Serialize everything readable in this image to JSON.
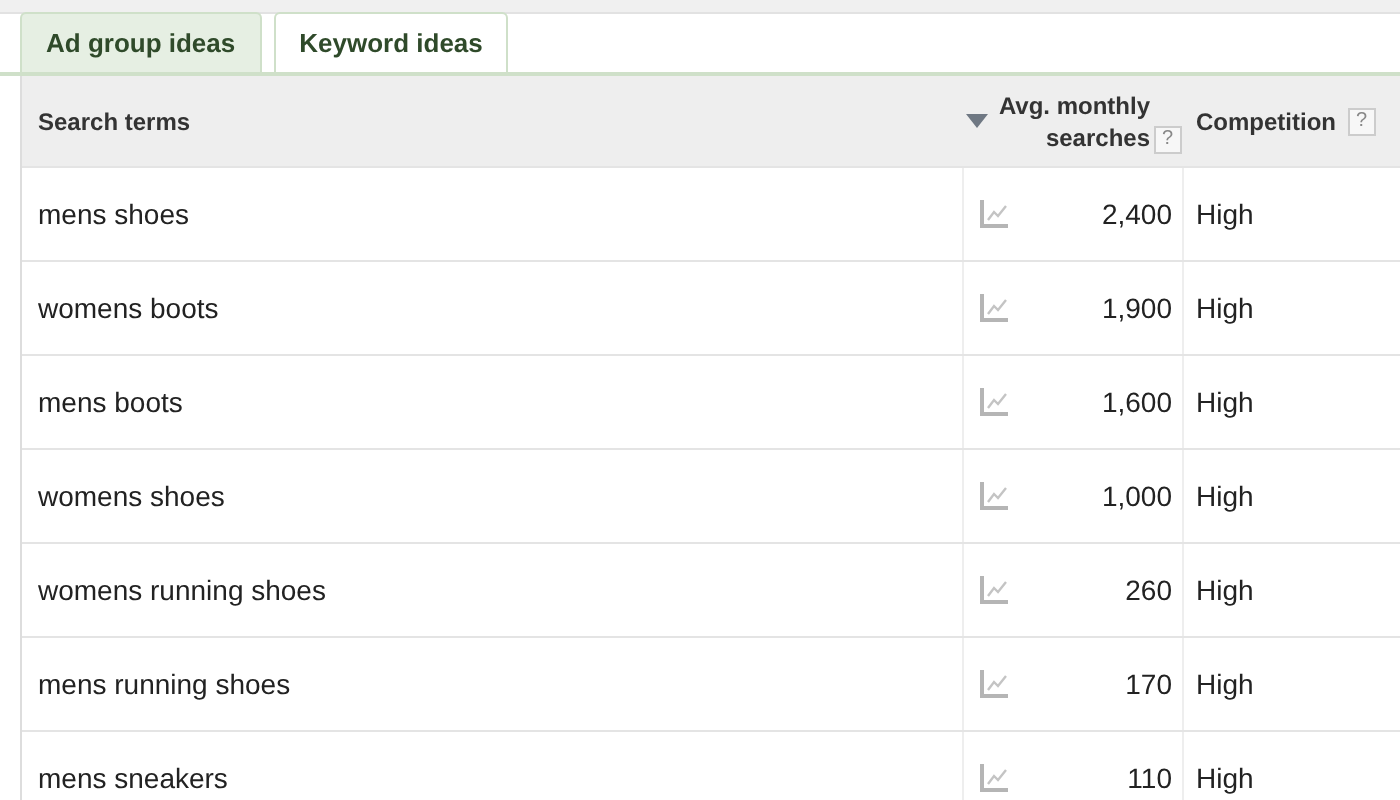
{
  "tabs": [
    {
      "label": "Ad group ideas",
      "selected": false
    },
    {
      "label": "Keyword ideas",
      "selected": true
    }
  ],
  "table": {
    "columns": [
      {
        "label": "Search terms"
      },
      {
        "label": "Avg. monthly searches",
        "help": "?",
        "sorted": true
      },
      {
        "label": "Competition",
        "help": "?"
      }
    ],
    "rows": [
      {
        "term": "mens shoes",
        "searches": "2,400",
        "competition": "High"
      },
      {
        "term": "womens boots",
        "searches": "1,900",
        "competition": "High"
      },
      {
        "term": "mens boots",
        "searches": "1,600",
        "competition": "High"
      },
      {
        "term": "womens shoes",
        "searches": "1,000",
        "competition": "High"
      },
      {
        "term": "womens running shoes",
        "searches": "260",
        "competition": "High"
      },
      {
        "term": "mens running shoes",
        "searches": "170",
        "competition": "High"
      },
      {
        "term": "mens sneakers",
        "searches": "110",
        "competition": "High"
      }
    ]
  }
}
